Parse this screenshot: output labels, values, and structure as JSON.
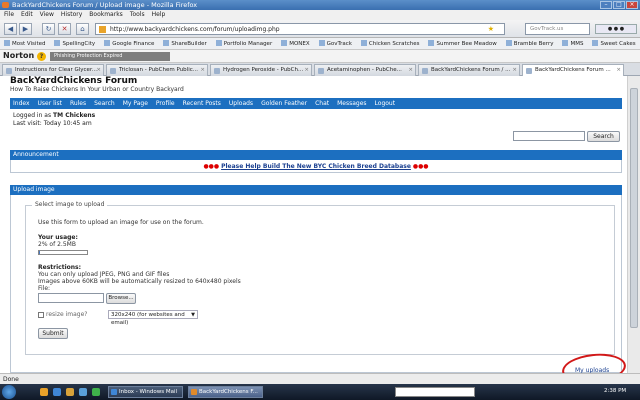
{
  "window": {
    "title": "BackYardChickens Forum / Upload image - Mozilla Firefox"
  },
  "menu": [
    "File",
    "Edit",
    "View",
    "History",
    "Bookmarks",
    "Tools",
    "Help"
  ],
  "nav": {
    "url": "http://www.backyardchickens.com/forum/uploadimg.php",
    "search_placeholder": "GovTrack.us"
  },
  "bookmarks": [
    "Most Visited",
    "SpellingCity",
    "Google Finance",
    "ShareBuilder",
    "Portfolio Manager",
    "MONEX",
    "GovTrack",
    "Chicken Scratches",
    "Summer Bee Meadow",
    "Bramble Berry",
    "MMS",
    "Sweet Cakes"
  ],
  "norton": {
    "logo": "Norton",
    "status": "Phishing Protection Expired"
  },
  "tabs": [
    "Instructions for Clear Glycer...",
    "Triclosan - PubChem Public...",
    "Hydrogen Peroxide - PubCh...",
    "Acetaminophen - PubChe...",
    "BackYardChickens Forum / ...",
    "BackYardChickens Forum ..."
  ],
  "site": {
    "title": "BackYardChickens Forum",
    "tagline": "How To Raise Chickens In Your Urban or Country Backyard",
    "nav": [
      "Index",
      "User list",
      "Rules",
      "Search",
      "My Page",
      "Profile",
      "Recent Posts",
      "Uploads",
      "Golden Feather",
      "Chat",
      "Messages",
      "Logout"
    ],
    "logged_prefix": "Logged in as",
    "user": "TM Chickens",
    "last_visit": "Last visit: Today 10:45 am",
    "search_button": "Search"
  },
  "announcement": {
    "heading": "Announcement",
    "dots": "●●●",
    "link": "Please Help Build The New BYC Chicken Breed Database"
  },
  "upload": {
    "heading": "Upload image",
    "legend": "Select image to upload",
    "intro": "Use this form to upload an image for use on the forum.",
    "usage_label": "Your usage:",
    "usage_value": "2% of 2.5MB",
    "usage_fraction": 0.02,
    "restrictions_label": "Restrictions:",
    "restriction_1": "You can only upload JPEG, PNG and GIF files",
    "restriction_2": "Images above 60KB will be automatically resized to 640x480 pixels",
    "file_label": "File:",
    "browse": "Browse...",
    "resize_label": "resize image?",
    "resize_option": "320x240 (for websites and email)",
    "submit": "Submit",
    "my_uploads": "My uploads"
  },
  "status": "Done",
  "taskbar": {
    "tasks": [
      "Inbox - Windows Mail",
      "BackYardChickens F..."
    ],
    "time": "2:38 PM"
  }
}
